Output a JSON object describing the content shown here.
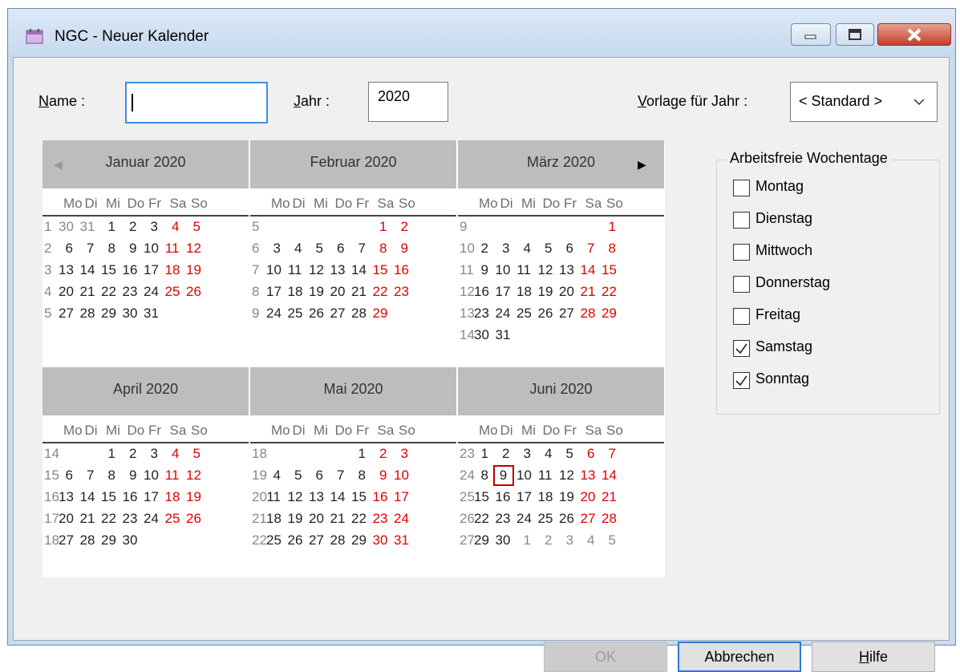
{
  "window": {
    "title": "NGC - Neuer Kalender",
    "icon": "calendar-icon",
    "controls": [
      "minimize-icon",
      "maximize-icon",
      "close-icon"
    ]
  },
  "form": {
    "name_label": "Name :",
    "name_value": "",
    "year_label": "Jahr :",
    "year_value": "2020",
    "template_label": "Vorlage für Jahr :",
    "template_value": "< Standard >"
  },
  "calendar": {
    "weekday_header": [
      "Mo",
      "Di",
      "Mi",
      "Do",
      "Fr",
      "Sa",
      "So"
    ],
    "nav_prev_icon": "triangle-left-icon",
    "nav_next_icon": "triangle-right-icon",
    "highlight_color": "#e00000",
    "today_marker_color": "#c00000",
    "months": [
      {
        "title": "Januar 2020",
        "rows": [
          {
            "wk": "1",
            "days": [
              "30",
              "31",
              "1",
              "2",
              "3",
              "4",
              "5"
            ],
            "grey": [
              0,
              1
            ]
          },
          {
            "wk": "2",
            "days": [
              "6",
              "7",
              "8",
              "9",
              "10",
              "11",
              "12"
            ]
          },
          {
            "wk": "3",
            "days": [
              "13",
              "14",
              "15",
              "16",
              "17",
              "18",
              "19"
            ]
          },
          {
            "wk": "4",
            "days": [
              "20",
              "21",
              "22",
              "23",
              "24",
              "25",
              "26"
            ]
          },
          {
            "wk": "5",
            "days": [
              "27",
              "28",
              "29",
              "30",
              "31",
              "",
              ""
            ]
          }
        ]
      },
      {
        "title": "Februar 2020",
        "rows": [
          {
            "wk": "5",
            "days": [
              "",
              "",
              "",
              "",
              "",
              "1",
              "2"
            ]
          },
          {
            "wk": "6",
            "days": [
              "3",
              "4",
              "5",
              "6",
              "7",
              "8",
              "9"
            ]
          },
          {
            "wk": "7",
            "days": [
              "10",
              "11",
              "12",
              "13",
              "14",
              "15",
              "16"
            ]
          },
          {
            "wk": "8",
            "days": [
              "17",
              "18",
              "19",
              "20",
              "21",
              "22",
              "23"
            ]
          },
          {
            "wk": "9",
            "days": [
              "24",
              "25",
              "26",
              "27",
              "28",
              "29",
              ""
            ]
          }
        ]
      },
      {
        "title": "März 2020",
        "rows": [
          {
            "wk": "9",
            "days": [
              "",
              "",
              "",
              "",
              "",
              "",
              "1"
            ]
          },
          {
            "wk": "10",
            "days": [
              "2",
              "3",
              "4",
              "5",
              "6",
              "7",
              "8"
            ]
          },
          {
            "wk": "11",
            "days": [
              "9",
              "10",
              "11",
              "12",
              "13",
              "14",
              "15"
            ]
          },
          {
            "wk": "12",
            "days": [
              "16",
              "17",
              "18",
              "19",
              "20",
              "21",
              "22"
            ]
          },
          {
            "wk": "13",
            "days": [
              "23",
              "24",
              "25",
              "26",
              "27",
              "28",
              "29"
            ]
          },
          {
            "wk": "14",
            "days": [
              "30",
              "31",
              "",
              "",
              "",
              "",
              ""
            ]
          }
        ]
      },
      {
        "title": "April 2020",
        "rows": [
          {
            "wk": "14",
            "days": [
              "",
              "",
              "1",
              "2",
              "3",
              "4",
              "5"
            ]
          },
          {
            "wk": "15",
            "days": [
              "6",
              "7",
              "8",
              "9",
              "10",
              "11",
              "12"
            ]
          },
          {
            "wk": "16",
            "days": [
              "13",
              "14",
              "15",
              "16",
              "17",
              "18",
              "19"
            ]
          },
          {
            "wk": "17",
            "days": [
              "20",
              "21",
              "22",
              "23",
              "24",
              "25",
              "26"
            ]
          },
          {
            "wk": "18",
            "days": [
              "27",
              "28",
              "29",
              "30",
              "",
              "",
              ""
            ]
          }
        ]
      },
      {
        "title": "Mai 2020",
        "rows": [
          {
            "wk": "18",
            "days": [
              "",
              "",
              "",
              "",
              "1",
              "2",
              "3"
            ]
          },
          {
            "wk": "19",
            "days": [
              "4",
              "5",
              "6",
              "7",
              "8",
              "9",
              "10"
            ]
          },
          {
            "wk": "20",
            "days": [
              "11",
              "12",
              "13",
              "14",
              "15",
              "16",
              "17"
            ]
          },
          {
            "wk": "21",
            "days": [
              "18",
              "19",
              "20",
              "21",
              "22",
              "23",
              "24"
            ]
          },
          {
            "wk": "22",
            "days": [
              "25",
              "26",
              "27",
              "28",
              "29",
              "30",
              "31"
            ]
          }
        ]
      },
      {
        "title": "Juni 2020",
        "rows": [
          {
            "wk": "23",
            "days": [
              "1",
              "2",
              "3",
              "4",
              "5",
              "6",
              "7"
            ]
          },
          {
            "wk": "24",
            "days": [
              "8",
              "9",
              "10",
              "11",
              "12",
              "13",
              "14"
            ],
            "today": 1
          },
          {
            "wk": "25",
            "days": [
              "15",
              "16",
              "17",
              "18",
              "19",
              "20",
              "21"
            ]
          },
          {
            "wk": "26",
            "days": [
              "22",
              "23",
              "24",
              "25",
              "26",
              "27",
              "28"
            ]
          },
          {
            "wk": "27",
            "days": [
              "29",
              "30",
              "1",
              "2",
              "3",
              "4",
              "5"
            ],
            "grey": [
              2,
              3,
              4,
              5,
              6
            ]
          }
        ]
      }
    ]
  },
  "workdays": {
    "title": "Arbeitsfreie Wochentage",
    "items": [
      {
        "label": "Montag",
        "checked": false
      },
      {
        "label": "Dienstag",
        "checked": false
      },
      {
        "label": "Mittwoch",
        "checked": false
      },
      {
        "label": "Donnerstag",
        "checked": false
      },
      {
        "label": "Freitag",
        "checked": false
      },
      {
        "label": "Samstag",
        "checked": true
      },
      {
        "label": "Sonntag",
        "checked": true
      }
    ]
  },
  "buttons": {
    "ok": "OK",
    "cancel": "Abbrechen",
    "help": "Hilfe"
  }
}
